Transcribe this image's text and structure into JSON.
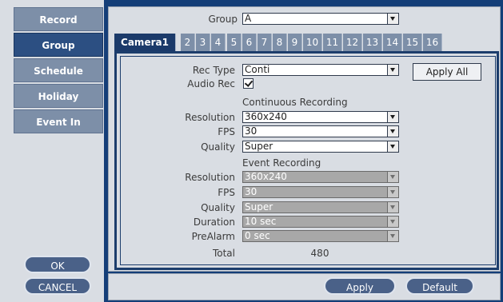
{
  "sidebar": {
    "items": [
      {
        "label": "Record",
        "active": false
      },
      {
        "label": "Group",
        "active": true
      },
      {
        "label": "Schedule",
        "active": false
      },
      {
        "label": "Holiday",
        "active": false
      },
      {
        "label": "Event In",
        "active": false
      }
    ],
    "ok_label": "OK",
    "cancel_label": "CANCEL"
  },
  "group": {
    "label": "Group",
    "value": "A"
  },
  "tabs": [
    "Camera1",
    "2",
    "3",
    "4",
    "5",
    "6",
    "7",
    "8",
    "9",
    "10",
    "11",
    "12",
    "13",
    "14",
    "15",
    "16"
  ],
  "settings": {
    "rec_type_label": "Rec Type",
    "rec_type_value": "Conti",
    "audio_rec_label": "Audio Rec",
    "audio_rec_checked": true,
    "apply_all_label": "Apply All",
    "continuous": {
      "title": "Continuous Recording",
      "resolution_label": "Resolution",
      "resolution_value": "360x240",
      "fps_label": "FPS",
      "fps_value": "30",
      "quality_label": "Quality",
      "quality_value": "Super"
    },
    "event": {
      "title": "Event Recording",
      "resolution_label": "Resolution",
      "resolution_value": "360x240",
      "fps_label": "FPS",
      "fps_value": "30",
      "quality_label": "Quality",
      "quality_value": "Super",
      "duration_label": "Duration",
      "duration_value": "10 sec",
      "prealarm_label": "PreAlarm",
      "prealarm_value": "0 sec"
    },
    "total_label": "Total",
    "total_value": "480"
  },
  "footer": {
    "apply_label": "Apply",
    "default_label": "Default"
  },
  "colors": {
    "background": "#143e78",
    "panel": "#d9dde3",
    "nav_active": "#2c4f82",
    "tab_active": "#1b3a6a"
  }
}
